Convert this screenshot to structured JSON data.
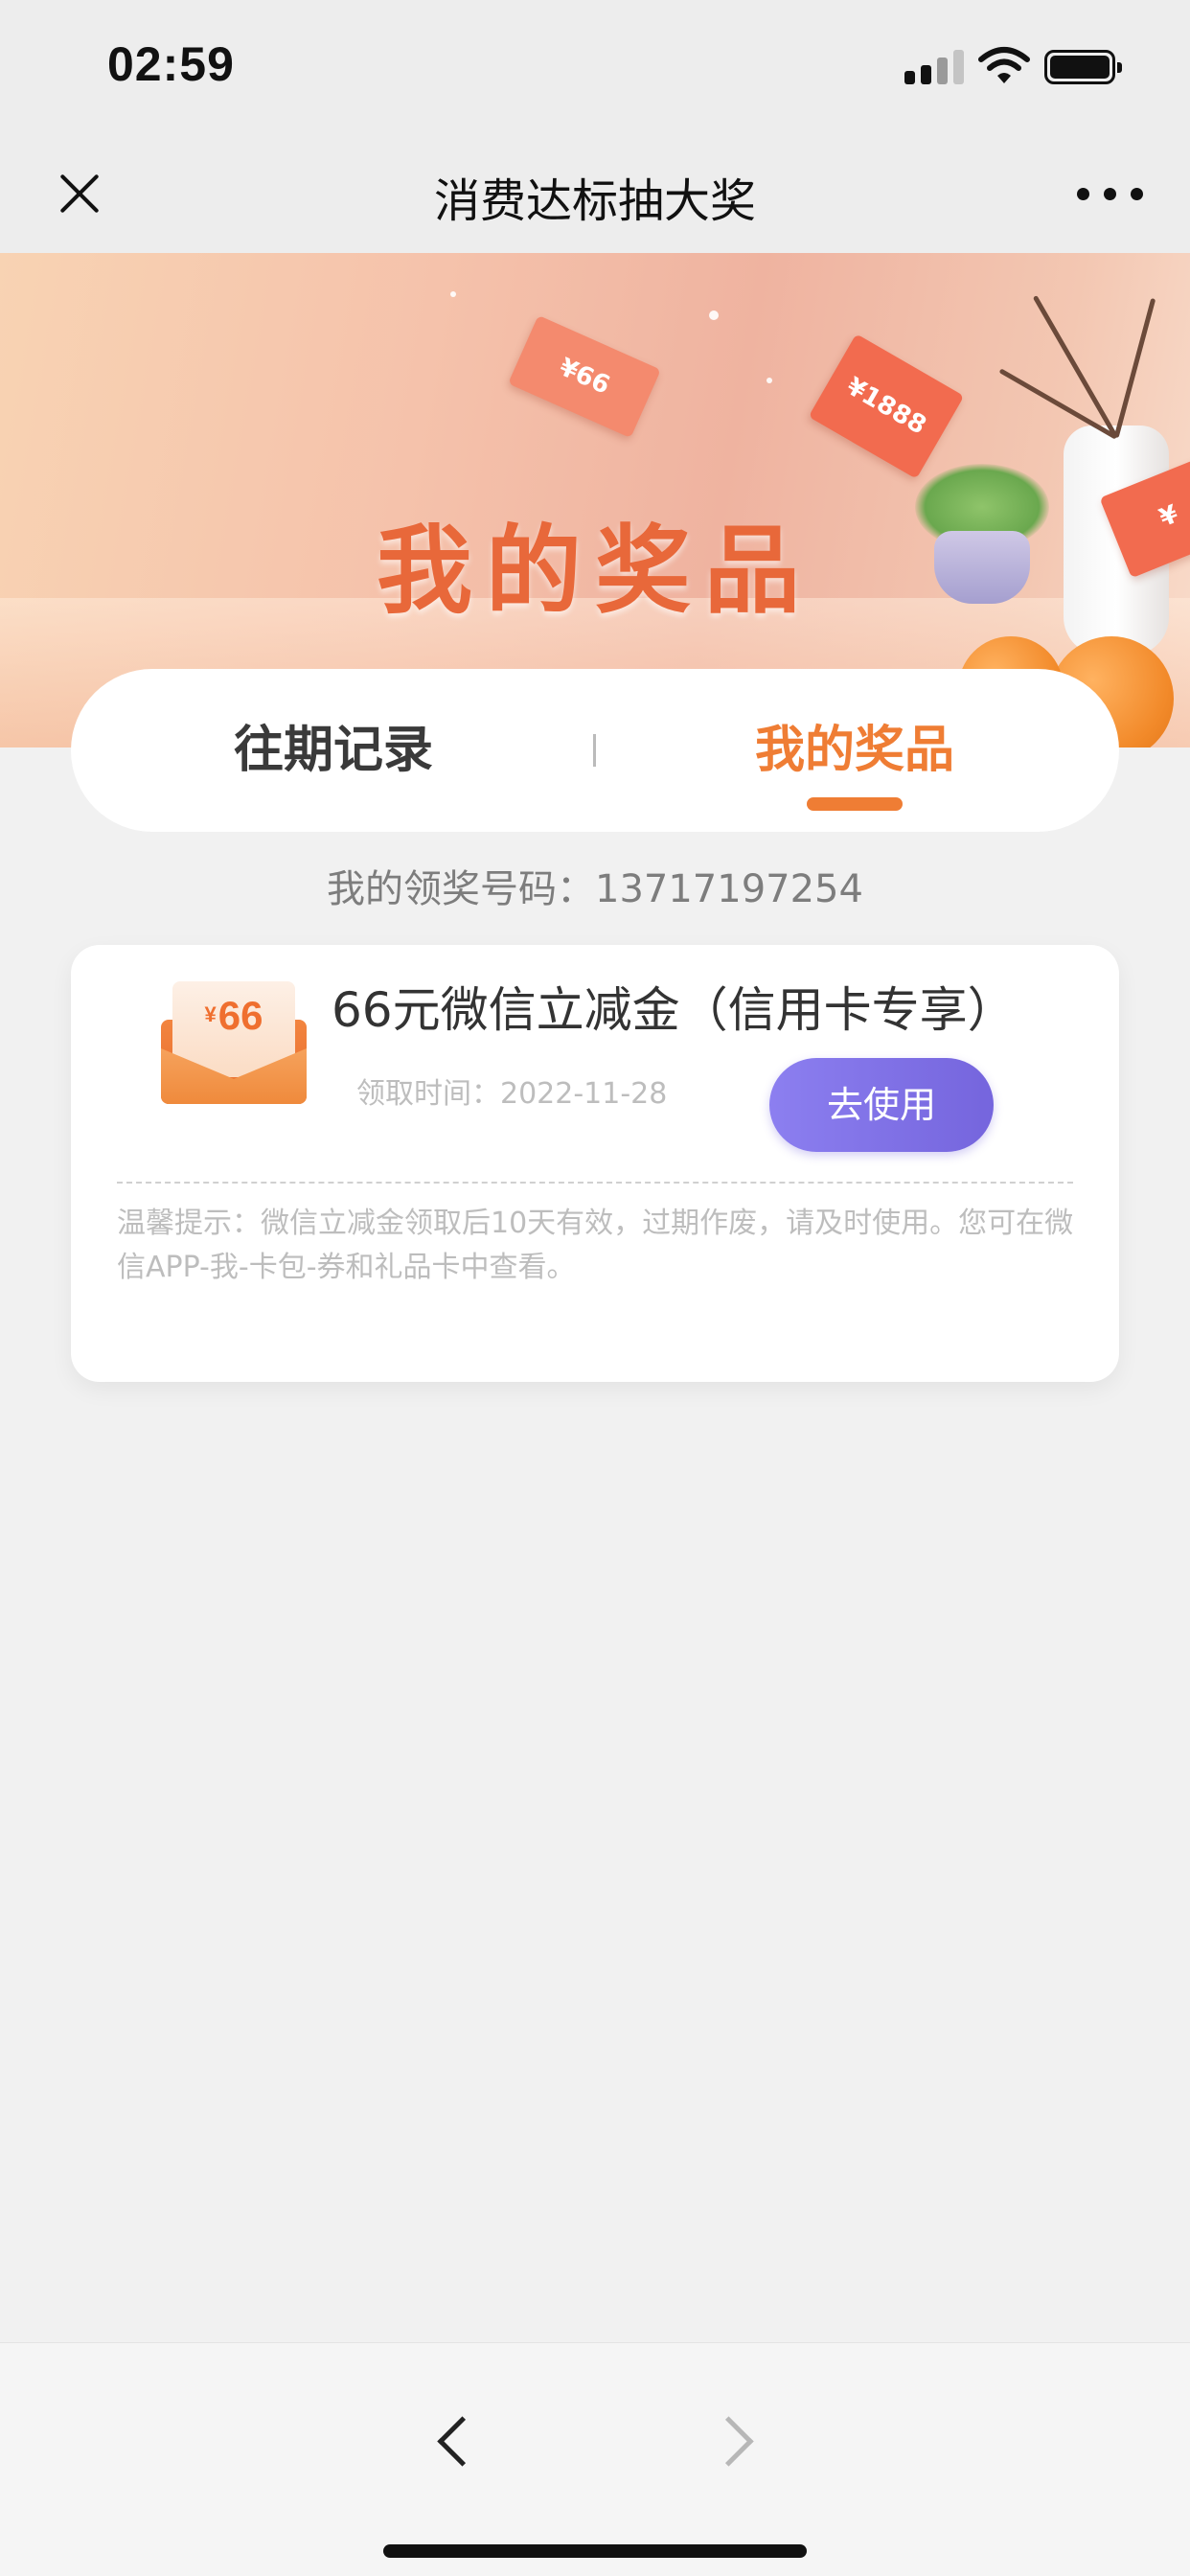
{
  "status_bar": {
    "time": "02:59"
  },
  "nav": {
    "title": "消费达标抽大奖",
    "close_icon": "close-icon",
    "more_icon": "more-icon"
  },
  "banner": {
    "title": "我的奖品",
    "ticket_labels": [
      "¥66",
      "¥1888",
      "¥"
    ]
  },
  "tabs": [
    {
      "label": "往期记录",
      "active": false
    },
    {
      "label": "我的奖品",
      "active": true
    }
  ],
  "prize_code_line": "我的领奖号码：13717197254",
  "prize": {
    "icon_amount": "66",
    "icon_currency": "¥",
    "name": "66元微信立减金（信用卡专享）",
    "claim_time": "领取时间：2022-11-28",
    "use_button": "去使用",
    "tip": "温馨提示：微信立减金领取后10天有效，过期作废，请及时使用。您可在微信APP-我-卡包-券和礼品卡中查看。"
  },
  "bottom_nav": {
    "back_icon": "chevron-left-icon",
    "forward_icon": "chevron-right-icon",
    "forward_enabled": false
  },
  "colors": {
    "accent": "#ef7d34",
    "button": "#7a6be3",
    "background": "#f1f1f1"
  }
}
